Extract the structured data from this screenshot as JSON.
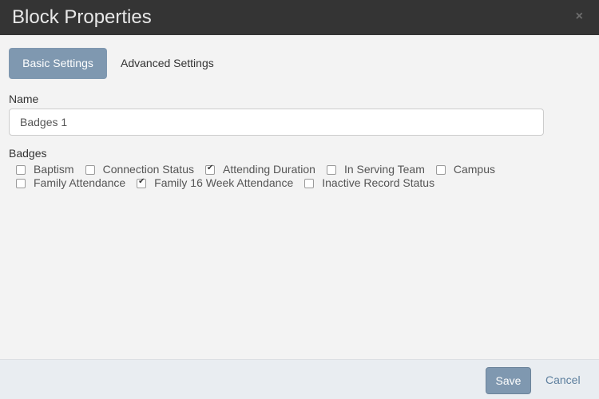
{
  "dialog": {
    "title": "Block Properties",
    "close_glyph": "×"
  },
  "tabs": [
    {
      "label": "Basic Settings",
      "active": true
    },
    {
      "label": "Advanced Settings",
      "active": false
    }
  ],
  "name_field": {
    "label": "Name",
    "value": "Badges 1"
  },
  "badges": {
    "label": "Badges",
    "options": [
      {
        "label": "Baptism",
        "checked": false
      },
      {
        "label": "Connection Status",
        "checked": false
      },
      {
        "label": "Attending Duration",
        "checked": true
      },
      {
        "label": "In Serving Team",
        "checked": false
      },
      {
        "label": "Campus",
        "checked": false
      },
      {
        "label": "Family Attendance",
        "checked": false
      },
      {
        "label": "Family 16 Week Attendance",
        "checked": true
      },
      {
        "label": "Inactive Record Status",
        "checked": false
      }
    ]
  },
  "footer": {
    "save_label": "Save",
    "cancel_label": "Cancel"
  },
  "colors": {
    "header_bg": "#343434",
    "accent": "#7f98b0",
    "link": "#5d7f9e",
    "footer_bg": "#e9edf1"
  }
}
